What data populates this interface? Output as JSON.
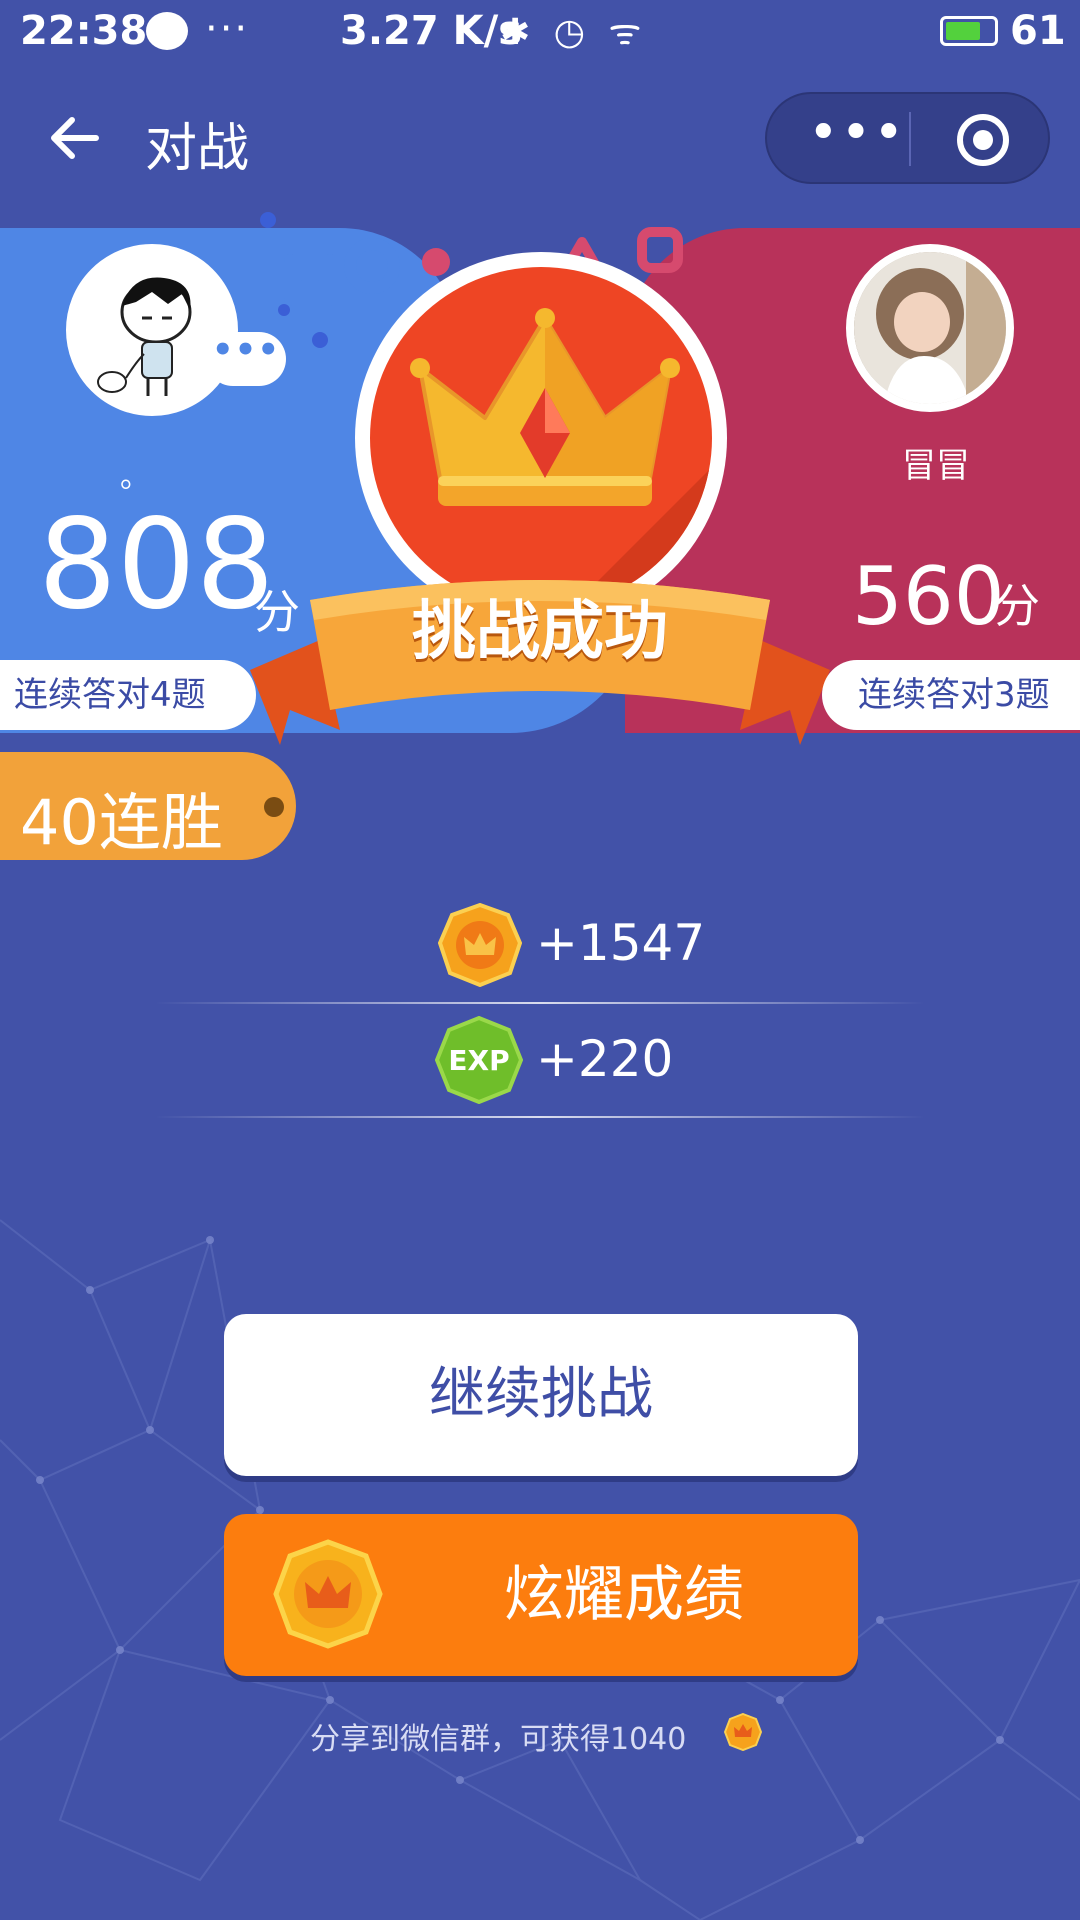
{
  "status_bar": {
    "time": "22:38",
    "dots": "···",
    "speed": "3.27 K/s",
    "icons": "✱ ◷ ᯤ",
    "battery_level": "61"
  },
  "nav": {
    "title": "对战",
    "more_label": "•••"
  },
  "battle": {
    "result_text": "挑战成功",
    "left_player": {
      "name": "。",
      "score": "808",
      "score_unit": "分",
      "streak_text": "连续答对4题",
      "chat_dots": "•••"
    },
    "right_player": {
      "name": "冒冒",
      "score": "560",
      "score_unit": "分",
      "streak_text": "连续答对3题"
    }
  },
  "win_streak": {
    "label": "40连胜"
  },
  "rewards": {
    "coins": "+1547",
    "exp": "+220",
    "exp_badge": "EXP"
  },
  "buttons": {
    "continue_label": "继续挑战",
    "show_label": "炫耀成绩"
  },
  "share": {
    "text": "分享到微信群，可获得1040"
  },
  "colors": {
    "background": "#4252a8",
    "left_panel": "#4f86e5",
    "right_panel": "#b8325a",
    "accent_orange": "#fc7d0e",
    "medal_red": "#ee4524"
  }
}
